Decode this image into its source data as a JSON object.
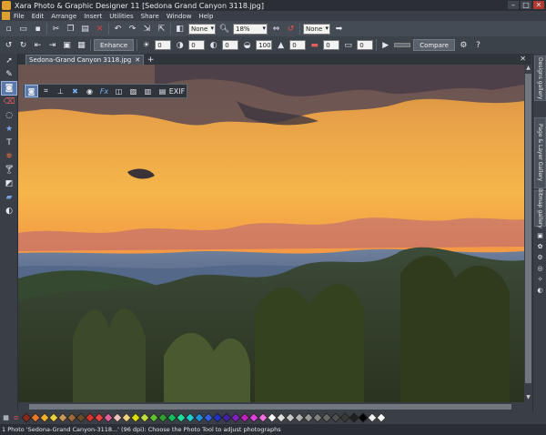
{
  "window": {
    "title": "Xara Photo & Graphic Designer 11   [Sedona Grand Canyon 3118.jpg]"
  },
  "menu": [
    "File",
    "Edit",
    "Arrange",
    "Insert",
    "Utilities",
    "Share",
    "Window",
    "Help"
  ],
  "toolbar1": {
    "quality_combo": "None",
    "zoom_value": "18%",
    "selector_combo": "None"
  },
  "toolbar2": {
    "enhance_label": "Enhance",
    "compare_label": "Compare",
    "values": [
      "0",
      "0",
      "0",
      "100",
      "0",
      "0",
      "0"
    ]
  },
  "tab": {
    "label": "Sedona-Grand Canyon 3118.jpg"
  },
  "photo_infobar": {
    "exif_label": "EXIF"
  },
  "galleries": [
    "Designs gallery",
    "Page & Layer Gallery",
    "Bitmap gallery"
  ],
  "palette": {
    "colors": [
      "#8b2a1a",
      "#e87a2a",
      "#f2b030",
      "#e8d040",
      "#c89a5a",
      "#a06a3a",
      "#6a4a2a",
      "#d8322a",
      "#f04040",
      "#e0609a",
      "#f0c0c0",
      "#f0d080",
      "#e0e000",
      "#c0e040",
      "#60c030",
      "#30a030",
      "#10c060",
      "#20e0a0",
      "#20d0d0",
      "#2090e0",
      "#3060e0",
      "#2030c0",
      "#4020a0",
      "#8020c0",
      "#c020c0",
      "#e040e0",
      "#f070e0",
      "#ffffff",
      "#e0e0e0",
      "#c8c8c8",
      "#b0b0b0",
      "#989898",
      "#808080",
      "#686868",
      "#505050",
      "#383838",
      "#202020",
      "#000000",
      "#f0f0f0",
      "#ffffff"
    ]
  },
  "status": {
    "text": "1 Photo 'Sedona-Grand Canyon-3118...' (96 dpi): Choose the Photo Tool to adjust photographs"
  }
}
